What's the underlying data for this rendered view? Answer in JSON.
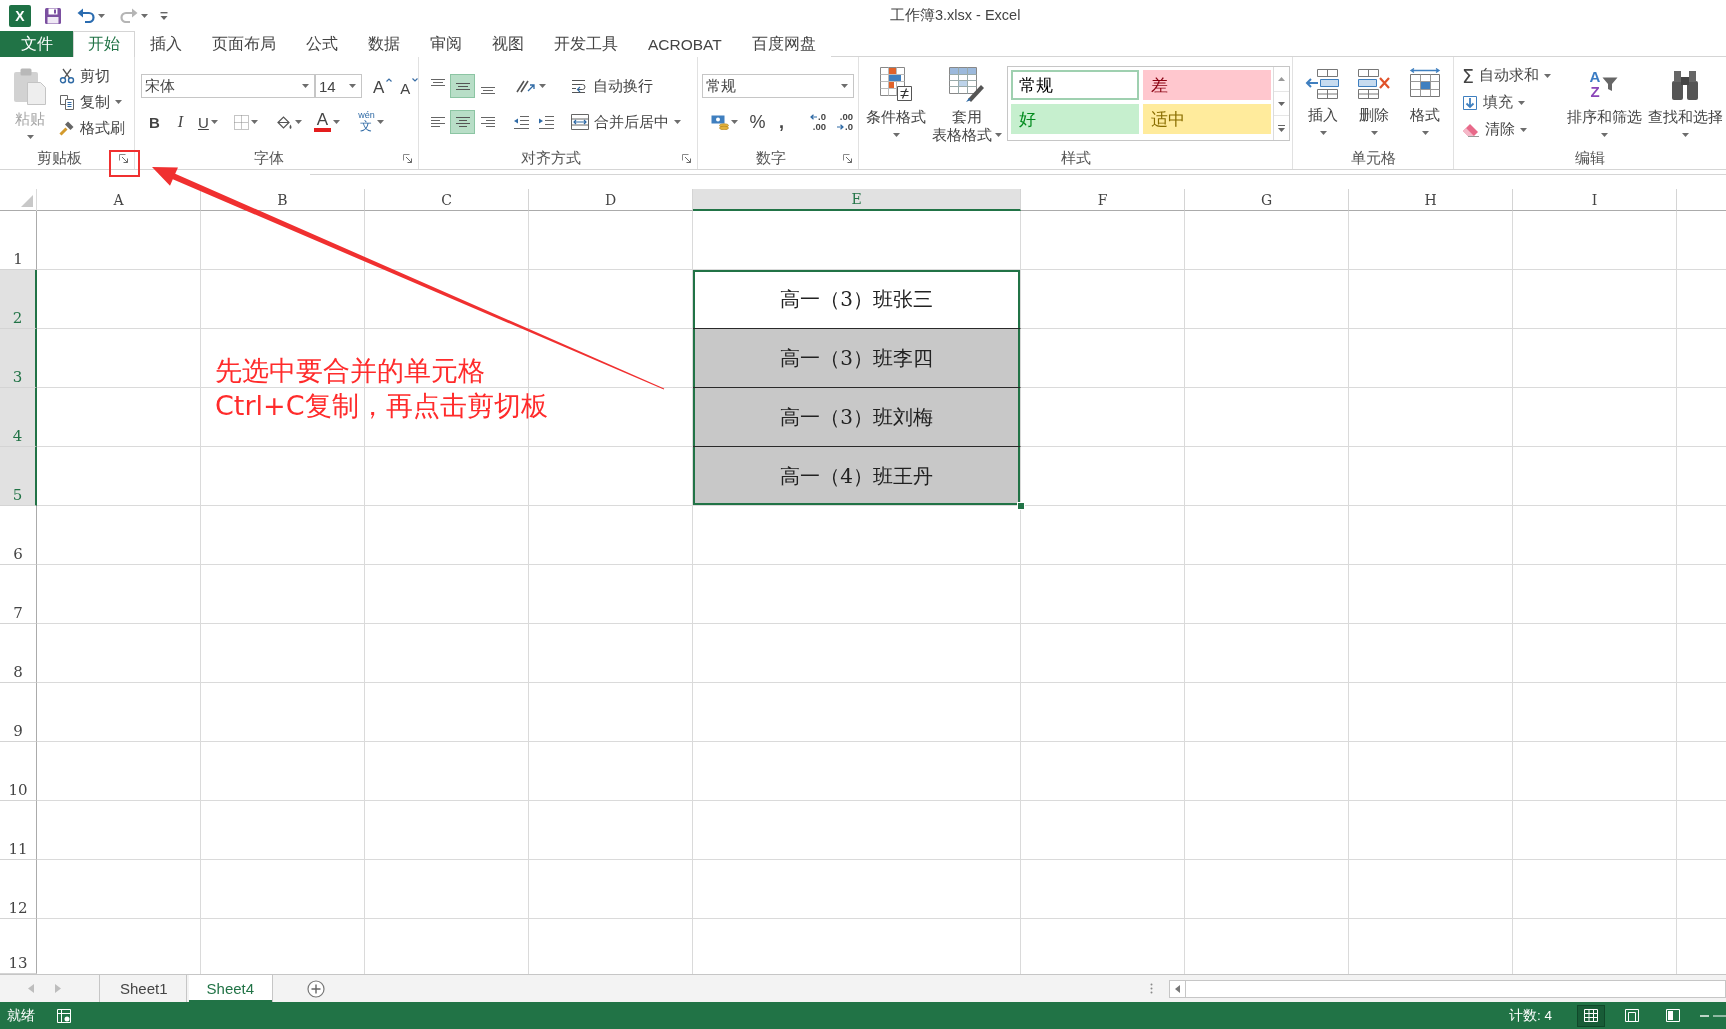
{
  "title_bar": {
    "app_icon": "X",
    "title": "工作簿3.xlsx - Excel"
  },
  "tabs": [
    {
      "label": "文件",
      "kind": "file",
      "selected": false
    },
    {
      "label": "开始",
      "kind": "tab",
      "selected": true
    },
    {
      "label": "插入",
      "kind": "tab",
      "selected": false
    },
    {
      "label": "页面布局",
      "kind": "tab",
      "selected": false
    },
    {
      "label": "公式",
      "kind": "tab",
      "selected": false
    },
    {
      "label": "数据",
      "kind": "tab",
      "selected": false
    },
    {
      "label": "审阅",
      "kind": "tab",
      "selected": false
    },
    {
      "label": "视图",
      "kind": "tab",
      "selected": false
    },
    {
      "label": "开发工具",
      "kind": "tab",
      "selected": false
    },
    {
      "label": "ACROBAT",
      "kind": "tab",
      "selected": false
    },
    {
      "label": "百度网盘",
      "kind": "tab",
      "selected": false
    }
  ],
  "ribbon": {
    "clipboard": {
      "label": "剪贴板",
      "paste": {
        "label": "粘贴",
        "disabled": true
      },
      "actions": [
        {
          "kind": "cut",
          "label": "剪切",
          "dropdown": false
        },
        {
          "kind": "copy",
          "label": "复制",
          "dropdown": true
        },
        {
          "kind": "painter",
          "label": "格式刷",
          "dropdown": false
        }
      ]
    },
    "font": {
      "label": "字体",
      "font_name": "宋体",
      "font_size": "14",
      "grow": "A",
      "shrink": "A",
      "bold": "B",
      "italic": "I",
      "underline": "U",
      "font_color": "A",
      "phonetic": {
        "pinyin": "wén",
        "character": "文"
      }
    },
    "alignment": {
      "label": "对齐方式",
      "vertical": [
        {
          "kind": "top",
          "selected": false
        },
        {
          "kind": "middle",
          "selected": true
        },
        {
          "kind": "bottom",
          "selected": false
        }
      ],
      "horizontal": [
        {
          "kind": "left",
          "selected": false
        },
        {
          "kind": "center",
          "selected": true
        },
        {
          "kind": "right",
          "selected": false
        }
      ],
      "wrap_text": "自动换行",
      "merge_center": "合并后居中"
    },
    "number": {
      "label": "数字",
      "format": "常规",
      "percent": "%",
      "comma": ",",
      "increase_decimal": {
        "top": ".0",
        "bottom": ".00"
      },
      "decrease_decimal": {
        "top": ".00",
        "bottom": ".0"
      }
    },
    "styles": {
      "label": "样式",
      "conditional": "条件格式",
      "table_format": [
        "套用",
        "表格格式"
      ],
      "gallery": [
        {
          "label": "常规",
          "color": "#ffffff",
          "selected": true
        },
        {
          "label": "差",
          "color": "#ffc7ce",
          "selected": false
        },
        {
          "label": "好",
          "color": "#c6efce",
          "selected": false
        },
        {
          "label": "适中",
          "color": "#ffeb9c",
          "selected": false
        }
      ]
    },
    "cells": {
      "label": "单元格",
      "buttons": [
        {
          "kind": "insert",
          "label": "插入"
        },
        {
          "kind": "delete",
          "label": "删除"
        },
        {
          "kind": "format",
          "label": "格式"
        }
      ]
    },
    "editing": {
      "label": "编辑",
      "actions": [
        {
          "kind": "autosum",
          "glyph": "Σ",
          "label": "自动求和"
        },
        {
          "kind": "fill",
          "label": "填充"
        },
        {
          "kind": "clear",
          "label": "清除"
        }
      ],
      "sort": {
        "label": "排序和筛选",
        "letters": [
          "A",
          "Z"
        ]
      },
      "find": {
        "label": "查找和选择"
      }
    }
  },
  "sheet": {
    "columns": [
      {
        "label": "A",
        "selected": false
      },
      {
        "label": "B",
        "selected": false
      },
      {
        "label": "C",
        "selected": false
      },
      {
        "label": "D",
        "selected": false
      },
      {
        "label": "E",
        "selected": true
      },
      {
        "label": "F",
        "selected": false
      },
      {
        "label": "G",
        "selected": false
      },
      {
        "label": "H",
        "selected": false
      },
      {
        "label": "I",
        "selected": false
      }
    ],
    "rows": [
      {
        "label": "1",
        "selected": false
      },
      {
        "label": "2",
        "selected": true,
        "cell_e": {
          "text": "高一（3）班张三",
          "active": true
        }
      },
      {
        "label": "3",
        "selected": true,
        "cell_e": {
          "text": "高一（3）班李四",
          "active": false
        }
      },
      {
        "label": "4",
        "selected": true,
        "cell_e": {
          "text": "高一（3）班刘梅",
          "active": false
        }
      },
      {
        "label": "5",
        "selected": true,
        "cell_e": {
          "text": "高一（4）班王丹",
          "active": false
        }
      },
      {
        "label": "6",
        "selected": false
      },
      {
        "label": "7",
        "selected": false
      },
      {
        "label": "8",
        "selected": false
      },
      {
        "label": "9",
        "selected": false
      },
      {
        "label": "10",
        "selected": false
      },
      {
        "label": "11",
        "selected": false
      },
      {
        "label": "12",
        "selected": false
      },
      {
        "label": "13",
        "selected": false
      }
    ]
  },
  "sheet_tabs": [
    {
      "label": "Sheet1",
      "selected": false
    },
    {
      "label": "Sheet4",
      "selected": true
    }
  ],
  "status_bar": {
    "status": "就绪",
    "count": "计数: 4",
    "views": [
      {
        "kind": "normal",
        "selected": true
      },
      {
        "kind": "page_layout",
        "selected": false
      },
      {
        "kind": "page_break",
        "selected": false
      }
    ]
  },
  "annotation": {
    "lines": [
      "先选中要合并的单元格",
      "Ctrl+C复制，再点击剪切板"
    ]
  }
}
